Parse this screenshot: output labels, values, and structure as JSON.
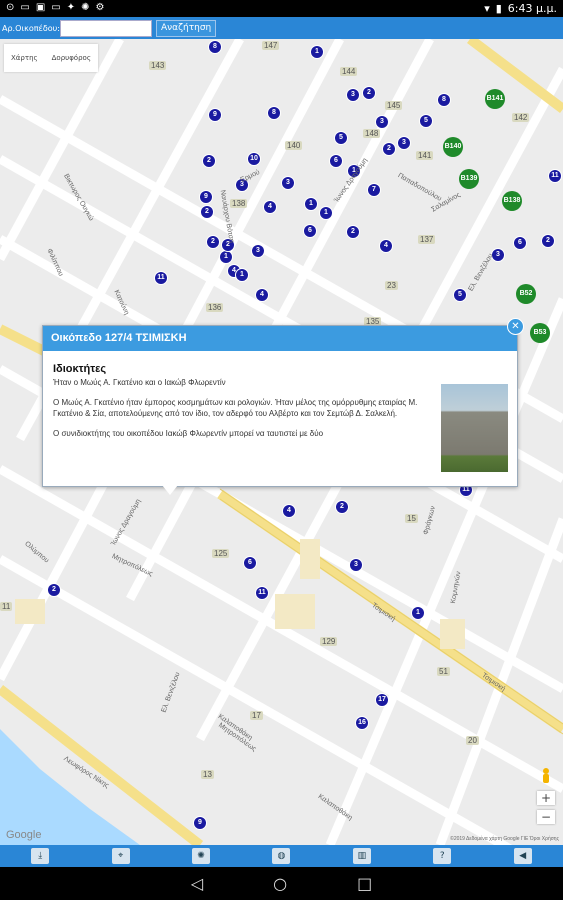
{
  "status": {
    "time": "6:43 μ.μ."
  },
  "toolbar": {
    "label": "Αρ.Οικοπέδου:",
    "input_value": "",
    "search_button": "Αναζήτηση"
  },
  "map": {
    "tabs": [
      "Χάρτης",
      "Δορυφόρος"
    ],
    "google": "Google",
    "copyright": "©2019 Δεδομένα χάρτη Google  ΓΙΕ  Όροι Χρήσης",
    "zoom_in": "+",
    "zoom_out": "−"
  },
  "popup": {
    "title": "Οικόπεδο 127/4 ΤΣΙΜΙΣΚΗ",
    "heading": "Ιδιοκτήτες",
    "line1": "Ήταν ο Μωύς Α. Γκατένιο και ο Ιακώβ Φλωρεντίν",
    "para1": "Ο Μωύς Α. Γκατένιο ήταν έμπορος κοσμημάτων και ρολογιών. Ήταν μέλος της ομόρρυθμης εταιρίας Μ. Γκατένιο & Σία, αποτελούμενης από τον ίδιο, τον αδερφό του Αλβέρτο και τον Σεμτώβ Δ. Σαλκελή.",
    "para2": "Ο συνιδιοκτήτης του οικοπέδου Ιακώβ Φλωρεντίν μπορεί να ταυτιστεί με δύο"
  },
  "markers": [
    "8",
    "1",
    "9",
    "8",
    "8",
    "10",
    "2",
    "11",
    "9",
    "3",
    "3",
    "4",
    "2",
    "1",
    "1",
    "6",
    "3",
    "2",
    "3",
    "5",
    "1",
    "7",
    "2",
    "3",
    "5",
    "2",
    "4",
    "3",
    "6",
    "2",
    "11",
    "5",
    "4",
    "6",
    "4",
    "3",
    "1",
    "1",
    "2",
    "2",
    "11",
    "4",
    "2",
    "6",
    "9",
    "16",
    "17",
    "3",
    "11",
    "2",
    "1"
  ],
  "green_markers": [
    "B141",
    "B140",
    "B139",
    "B138",
    "B52",
    "B53"
  ],
  "numbers": [
    "147",
    "143",
    "144",
    "145",
    "148",
    "140",
    "141",
    "142",
    "138",
    "137",
    "136",
    "135",
    "125",
    "129",
    "17",
    "13",
    "20",
    "15",
    "11",
    "51",
    "23"
  ],
  "streets": [
    "Τσιμισκή",
    "Τσιμισκή",
    "Λεωφόρος Νίκης",
    "Ελ. Βενιζέλου",
    "Ελ. Βενιζέλου",
    "Ίωνος Δραγούμη",
    "Ίωνος Δραγούμη",
    "Μητροπόλεως",
    "Μητροπόλεως",
    "Καλαποθάκη",
    "Καλαποθάκη",
    "Φράγκων",
    "Κομνηνών",
    "Βικτωρος Ουγκώ",
    "Ερμού",
    "Ολύμπου",
    "Κατούνη",
    "Φιλίππου",
    "Ναυάρχου Βότση",
    "Παπαδοπούλου",
    "Σαλαμίνος"
  ],
  "bottom": [
    "download-icon",
    "map-pin-icon",
    "bulb-icon",
    "globe-icon",
    "book-icon",
    "help-icon",
    "back-icon"
  ]
}
